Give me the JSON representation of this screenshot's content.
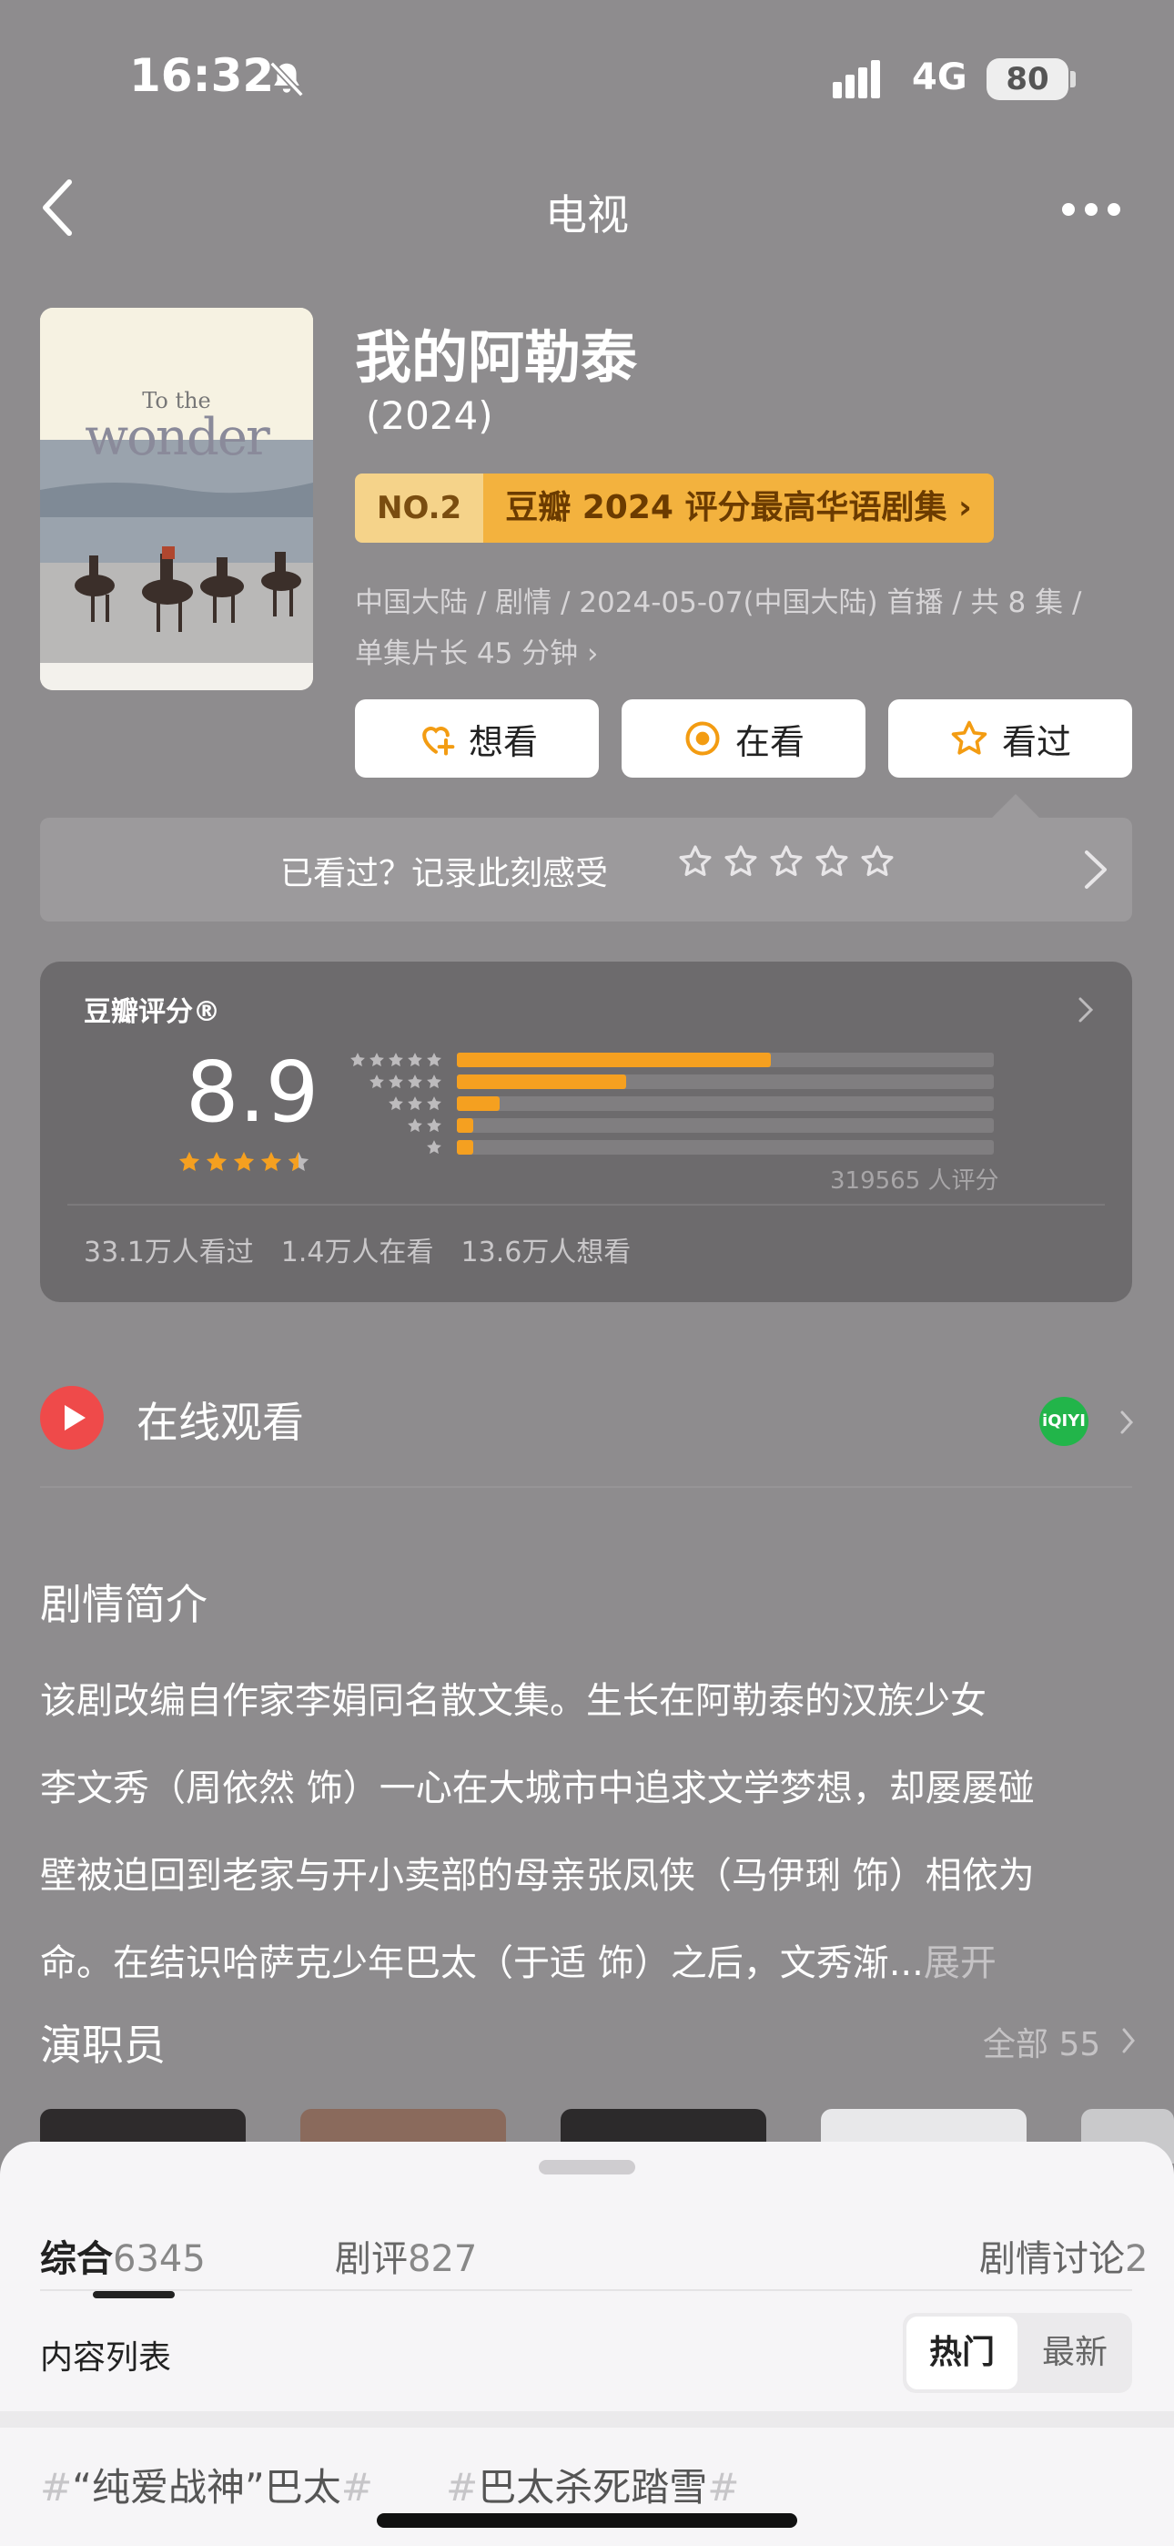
{
  "status": {
    "time": "16:32",
    "network": "4G",
    "battery": "80"
  },
  "nav": {
    "title": "电视"
  },
  "poster": {
    "title_small": "To the",
    "title_large": "wonder"
  },
  "show": {
    "title": "我的阿勒泰",
    "year": "(2024)",
    "rank_no": "NO.2",
    "rank_text": "豆瓣 2024 评分最高华语剧集",
    "meta_line1": "中国大陆 / 剧情 / 2024-05-07(中国大陆) 首播 / 共 8 集 /",
    "meta_line2": "单集片长 45 分钟"
  },
  "actions": [
    {
      "label": "想看",
      "icon": "heart-plus-icon"
    },
    {
      "label": "在看",
      "icon": "watching-icon"
    },
    {
      "label": "看过",
      "icon": "star-outline-icon"
    }
  ],
  "record": {
    "text": "已看过？记录此刻感受",
    "star_count": 5
  },
  "rating": {
    "label": "豆瓣评分®",
    "score": "8.9",
    "stars": 4.5,
    "distribution": [
      {
        "stars": 5,
        "fraction": 0.585
      },
      {
        "stars": 4,
        "fraction": 0.315
      },
      {
        "stars": 3,
        "fraction": 0.08
      },
      {
        "stars": 2,
        "fraction": 0.03
      },
      {
        "stars": 1,
        "fraction": 0.03
      }
    ],
    "count_text": "319565 人评分",
    "stats": [
      "33.1万人看过",
      "1.4万人在看",
      "13.6万人想看"
    ]
  },
  "online": {
    "label": "在线观看",
    "provider_icon": "iqiyi-icon",
    "provider_text": "iQIYI"
  },
  "synopsis": {
    "title": "剧情简介",
    "line1": "该剧改编自作家李娟同名散文集。生长在阿勒泰的汉族少女",
    "line2": "李文秀（周依然 饰）一心在大城市中追求文学梦想，却屡屡碰",
    "line3": "壁被迫回到老家与开小卖部的母亲张凤侠（马伊琍 饰）相依为",
    "line4": "命。在结识哈萨克少年巴太（于适 饰）之后，文秀渐...",
    "expand": "展开"
  },
  "cast": {
    "title": "演职员",
    "all": "全部 55"
  },
  "sheet": {
    "tabs": [
      {
        "label": "综合",
        "count": "6345"
      },
      {
        "label": "剧评",
        "count": "827"
      },
      {
        "label": "剧情讨论",
        "count": "2"
      }
    ],
    "list_label": "内容列表",
    "sort_hot": "热门",
    "sort_new": "最新",
    "topics": [
      "“纯爱战神”巴太",
      "巴太杀死踏雪"
    ]
  },
  "colors": {
    "accent_orange": "#f5a020",
    "rank_gold": "#f3b23e",
    "play_red": "#ef4a4a",
    "iqiyi_green": "#22b54a"
  }
}
